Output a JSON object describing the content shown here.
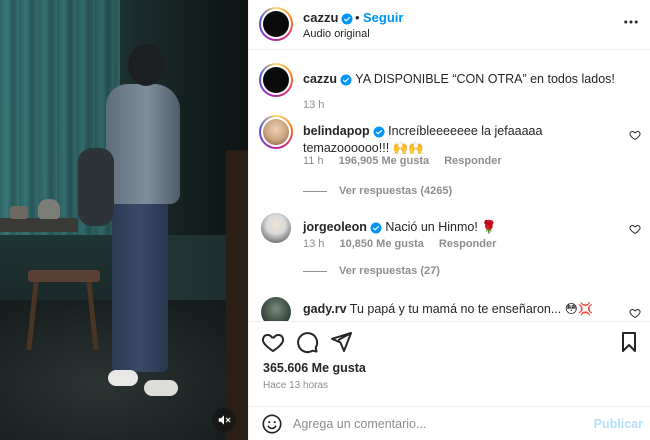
{
  "post": {
    "username": "cazzu",
    "follow_label": "Seguir",
    "separator": "•",
    "audio_label": "Audio original",
    "more_icon": "more-horizontal-icon"
  },
  "caption": {
    "username": "cazzu",
    "text": "YA DISPONIBLE “CON OTRA” en todos lados!",
    "time": "13 h"
  },
  "comments": [
    {
      "username": "belindapop",
      "text": "Increíbleeeeeee la jefaaaaa temazoooooo!!! 🙌🙌",
      "time": "11 h",
      "likes": "196,905 Me gusta",
      "reply": "Responder",
      "view_replies": "Ver respuestas (4265)",
      "avatar_color": "#c9a27e"
    },
    {
      "username": "jorgeoleon",
      "text": "Nació un Hinmo! 🌹",
      "time": "13 h",
      "likes": "10,850 Me gusta",
      "reply": "Responder",
      "view_replies": "Ver respuestas (27)",
      "avatar_color": "#d9d9d9"
    },
    {
      "username": "gady.rv",
      "text": "Tu papá y tu mamá no te enseñaron... 😳💢",
      "avatar_color": "#3a4a3e"
    }
  ],
  "footer": {
    "likes": "365.606 Me gusta",
    "time_ago": "Hace 13 horas"
  },
  "composer": {
    "placeholder": "Agrega un comentario...",
    "value": "",
    "post_label": "Publicar"
  },
  "colors": {
    "accent": "#0095f6",
    "verified": "#0095f6",
    "muted": "#8e8e8e",
    "post_disabled": "#b2dffc"
  }
}
